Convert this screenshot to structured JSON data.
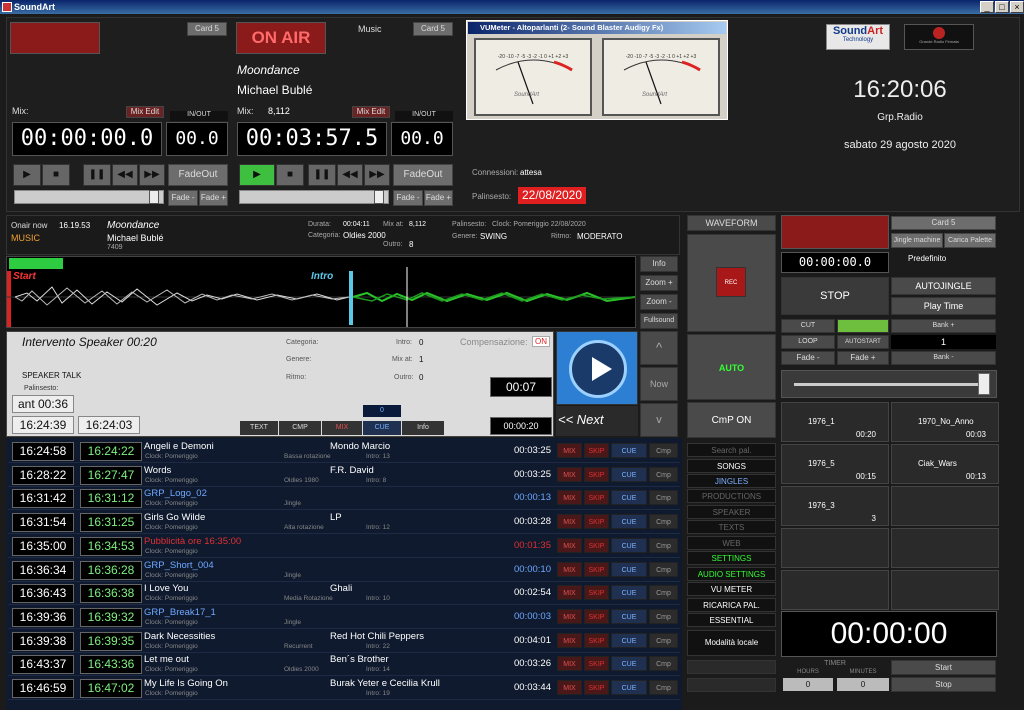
{
  "window": {
    "title": "SoundArt",
    "min": "_",
    "max": "□",
    "close": "×"
  },
  "deck1": {
    "card": "Card 5",
    "mix_label": "Mix:",
    "mix_edit": "Mix Edit",
    "inout": "IN/OUT",
    "time": "00:00:00.0",
    "aux": "00.0",
    "fadeout": "FadeOut",
    "fade_minus": "Fade -",
    "fade_plus": "Fade +"
  },
  "deck2": {
    "onair": "ON AIR",
    "category": "Music",
    "card": "Card 5",
    "title": "Moondance",
    "artist": "Michael Bublé",
    "mix_label": "Mix:",
    "mix_value": "8,112",
    "mix_edit": "Mix Edit",
    "inout": "IN/OUT",
    "time": "00:03:57.5",
    "aux": "00.0",
    "fadeout": "FadeOut",
    "fade_minus": "Fade -",
    "fade_plus": "Fade +"
  },
  "vumeter": {
    "title": "VUMeter - Altoparlanti (2- Sound Blaster Audigy Fx)",
    "scale": "-20 -10 -7 -5 -3 -2 -1 0 +1 +2 +3",
    "brand": "SoundArt"
  },
  "connection": {
    "label": "Connessioni:",
    "value": "attesa",
    "pal_label": "Palinsesto:",
    "pal_value": "22/08/2020"
  },
  "clock": {
    "time": "16:20:06",
    "group": "Grp.Radio",
    "date": "sabato 29 agosto 2020",
    "logo1a": "Sound",
    "logo1b": "Art",
    "logo1c": "Technology",
    "logo2": "Grande Radio Firmata"
  },
  "onair_info": {
    "label": "Onair now",
    "time": "16.19.53",
    "category": "MUSIC",
    "title": "Moondance",
    "artist": "Michael Bublé",
    "code": "7409",
    "durata_label": "Durata:",
    "durata": "00:04:11",
    "mixat_label": "Mix at:",
    "mixat": "8,112",
    "categoria_label": "Categoria:",
    "categoria": "Oldies 2000",
    "outro_label": "Outro:",
    "outro": "8",
    "palinsesto_label": "Palinsesto:",
    "palinsesto": "Clock: Pomeriggio 22/08/2020",
    "genere_label": "Genere:",
    "genere": "SWING",
    "ritmo_label": "Ritmo:",
    "ritmo": "MODERATO"
  },
  "waveform": {
    "start": "Start",
    "intro": "Intro",
    "info": "Info",
    "zoom_plus": "Zoom +",
    "zoom_minus": "Zoom -",
    "full": "Fullsound"
  },
  "speaker": {
    "title": "Intervento Speaker 00:20",
    "categoria": "Categoria:",
    "genere": "Genere:",
    "ritmo": "Ritmo:",
    "intro_label": "Intro:",
    "intro": "0",
    "mixat_label": "Mix at:",
    "mixat": "1",
    "outro_label": "Outro:",
    "outro": "0",
    "comp_label": "Compensazione:",
    "comp": "ON",
    "type": "SPEAKER TALK",
    "pal_label": "Palinsesto:",
    "ant": "ant 00:36",
    "t1": "16:24:39",
    "t2": "16:24:03",
    "tab_text": "TEXT",
    "tab_cmp": "CMP",
    "tab_mix": "MIX",
    "tab_cue": "CUE",
    "tab_info": "Info",
    "small_val": "0",
    "countdown": "00:07",
    "dur": "00:00:20",
    "next": "<< Next",
    "now": "Now",
    "up": "^",
    "down": "v"
  },
  "center": {
    "waveform": "WAVEFORM",
    "rec": "REC",
    "auto": "AUTO",
    "cmp": "CmP ON",
    "search": "Search pal.",
    "songs": "SONGS",
    "jingles": "JINGLES",
    "productions": "PRODUCTIONS",
    "speaker": "SPEAKER",
    "texts": "TEXTS",
    "web": "WEB",
    "settings": "SETTINGS",
    "audio": "AUDIO SETTINGS",
    "vu": "VU METER",
    "ricarica": "RICARICA PAL.",
    "essential": "ESSENTIAL",
    "modalita": "Modalità locale"
  },
  "right": {
    "card": "Card 5",
    "jingle_machine": "Jingle machine",
    "carica": "Carica Palette",
    "time": "00:00:00.0",
    "predef": "Predefinito",
    "stop": "STOP",
    "autojingle": "AUTOJINGLE",
    "playtime": "Play Time",
    "cut": "CUT",
    "mix": "MIX",
    "bankplus": "Bank +",
    "loop": "LOOP",
    "autostart": "AUTOSTART",
    "bank_value": "1",
    "fade_minus": "Fade -",
    "fade_plus": "Fade +",
    "bankminus": "Bank -",
    "big_time": "00:00:00",
    "timer": "TIMER",
    "hours": "HOURS",
    "minutes": "MINUTES",
    "h_val": "0",
    "m_val": "0",
    "start": "Start",
    "stopbtn": "Stop"
  },
  "carts": [
    {
      "name": "1976_1",
      "dur": "00:20"
    },
    {
      "name": "1970_No_Anno",
      "dur": "00:03"
    },
    {
      "name": "1976_5",
      "dur": "00:15"
    },
    {
      "name": "Ciak_Wars",
      "dur": "00:13"
    },
    {
      "name": "1976_3",
      "dur": "3"
    }
  ],
  "playlist": [
    {
      "t1": "16:24:58",
      "t2": "16:24:22",
      "title": "Angeli e Demoni",
      "clock": "Clock: Pomeriggio",
      "cat": "Bassa rotazione",
      "artist": "Mondo Marcio",
      "intro": "Intro: 13",
      "dur": "00:03:25",
      "tc": "#fff",
      "dc": "#fff"
    },
    {
      "t1": "16:28:22",
      "t2": "16:27:47",
      "title": "Words",
      "clock": "Clock: Pomeriggio",
      "cat": "Oldies 1980",
      "artist": "F.R. David",
      "intro": "Intro: 8",
      "dur": "00:03:25",
      "tc": "#fff",
      "dc": "#fff"
    },
    {
      "t1": "16:31:42",
      "t2": "16:31:12",
      "title": "GRP_Logo_02",
      "clock": "Clock: Pomeriggio",
      "cat": "Jingle",
      "artist": "",
      "intro": "",
      "dur": "00:00:13",
      "tc": "#6fa8ff",
      "dc": "#6fa8ff"
    },
    {
      "t1": "16:31:54",
      "t2": "16:31:25",
      "title": "Girls Go Wilde",
      "clock": "Clock: Pomeriggio",
      "cat": "Alta rotazione",
      "artist": "LP",
      "intro": "Intro: 12",
      "dur": "00:03:28",
      "tc": "#fff",
      "dc": "#fff"
    },
    {
      "t1": "16:35:00",
      "t2": "16:34:53",
      "title": "Pubblicità ore 16:35:00",
      "clock": "Clock: Pomeriggio",
      "cat": "",
      "artist": "",
      "intro": "",
      "dur": "00:01:35",
      "tc": "#e03030",
      "dc": "#e03030"
    },
    {
      "t1": "16:36:34",
      "t2": "16:36:28",
      "title": "GRP_Short_004",
      "clock": "Clock: Pomeriggio",
      "cat": "Jingle",
      "artist": "",
      "intro": "",
      "dur": "00:00:10",
      "tc": "#6fa8ff",
      "dc": "#6fa8ff"
    },
    {
      "t1": "16:36:43",
      "t2": "16:36:38",
      "title": "I Love You",
      "clock": "Clock: Pomeriggio",
      "cat": "Media Rotazione",
      "artist": "Ghali",
      "intro": "Intro: 10",
      "dur": "00:02:54",
      "tc": "#fff",
      "dc": "#fff"
    },
    {
      "t1": "16:39:36",
      "t2": "16:39:32",
      "title": "GRP_Break17_1",
      "clock": "Clock: Pomeriggio",
      "cat": "Jingle",
      "artist": "",
      "intro": "",
      "dur": "00:00:03",
      "tc": "#6fa8ff",
      "dc": "#6fa8ff"
    },
    {
      "t1": "16:39:38",
      "t2": "16:39:35",
      "title": "Dark Necessities",
      "clock": "Clock: Pomeriggio",
      "cat": "Recurrent",
      "artist": "Red Hot Chili Peppers",
      "intro": "Intro: 22",
      "dur": "00:04:01",
      "tc": "#fff",
      "dc": "#fff"
    },
    {
      "t1": "16:43:37",
      "t2": "16:43:36",
      "title": "Let me out",
      "clock": "Clock: Pomeriggio",
      "cat": "Oldies 2000",
      "artist": "Ben´s Brother",
      "intro": "Intro: 14",
      "dur": "00:03:26",
      "tc": "#fff",
      "dc": "#fff"
    },
    {
      "t1": "16:46:59",
      "t2": "16:47:02",
      "title": "My Life Is Going On",
      "clock": "Clock: Pomeriggio",
      "cat": "",
      "artist": "Burak Yeter e Cecilia Krull",
      "intro": "Intro: 19",
      "dur": "00:03:44",
      "tc": "#fff",
      "dc": "#fff"
    }
  ],
  "row_buttons": {
    "mix": "MIX",
    "skip": "SKIP",
    "cue": "CUE",
    "cmp": "Cmp"
  }
}
